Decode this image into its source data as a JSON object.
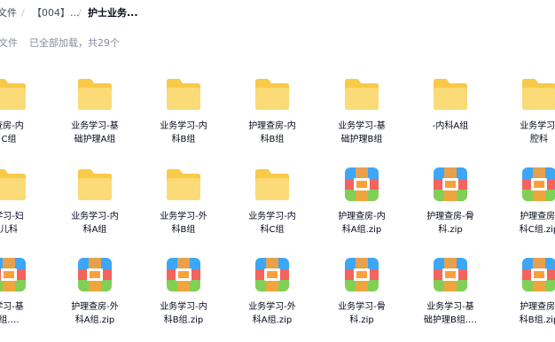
{
  "breadcrumb": {
    "items": [
      "文件",
      "【004】...",
      "护士业务..."
    ],
    "separator": "/"
  },
  "status": {
    "label": "文件",
    "summary": "已全部加载，共29个"
  },
  "files": [
    {
      "name": "查房-内\nC组",
      "type": "folder"
    },
    {
      "name": "业务学习-基\n础护理A组",
      "type": "folder"
    },
    {
      "name": "业务学习-内\n科B组",
      "type": "folder"
    },
    {
      "name": "护理查房-内\n科B组",
      "type": "folder"
    },
    {
      "name": "业务学习-基\n础护理B组",
      "type": "folder"
    },
    {
      "name": "-内科A组",
      "type": "folder"
    },
    {
      "name": "业务学习-\n腔科",
      "type": "folder"
    },
    {
      "name": "学习-妇\n儿科",
      "type": "folder"
    },
    {
      "name": "业务学习-内\n科A组",
      "type": "folder"
    },
    {
      "name": "业务学习-外\n科B组",
      "type": "folder"
    },
    {
      "name": "业务学习-内\n科C组",
      "type": "folder"
    },
    {
      "name": "护理查房-内\n科A组.zip",
      "type": "zip"
    },
    {
      "name": "护理查房-骨\n科.zip",
      "type": "zip"
    },
    {
      "name": "护理查房-\n科C组.zip",
      "type": "zip"
    },
    {
      "name": "学习-基\n组.…",
      "type": "zip"
    },
    {
      "name": "护理查房-外\n科A组.zip",
      "type": "zip"
    },
    {
      "name": "业务学习-内\n科B组.zip",
      "type": "zip"
    },
    {
      "name": "业务学习-外\n科A组.zip",
      "type": "zip"
    },
    {
      "name": "业务学习-骨\n科.zip",
      "type": "zip"
    },
    {
      "name": "业务学习-基\n础护理B组.…",
      "type": "zip"
    },
    {
      "name": "护理查房-\n科B组.zip",
      "type": "zip"
    }
  ],
  "colors": {
    "folder_back": "#f9c948",
    "folder_front": "#fbdb78",
    "zip_blue": "#3da6f7",
    "zip_red": "#f4635d",
    "zip_green": "#82cf57",
    "zip_clasp": "#f9a13a"
  }
}
